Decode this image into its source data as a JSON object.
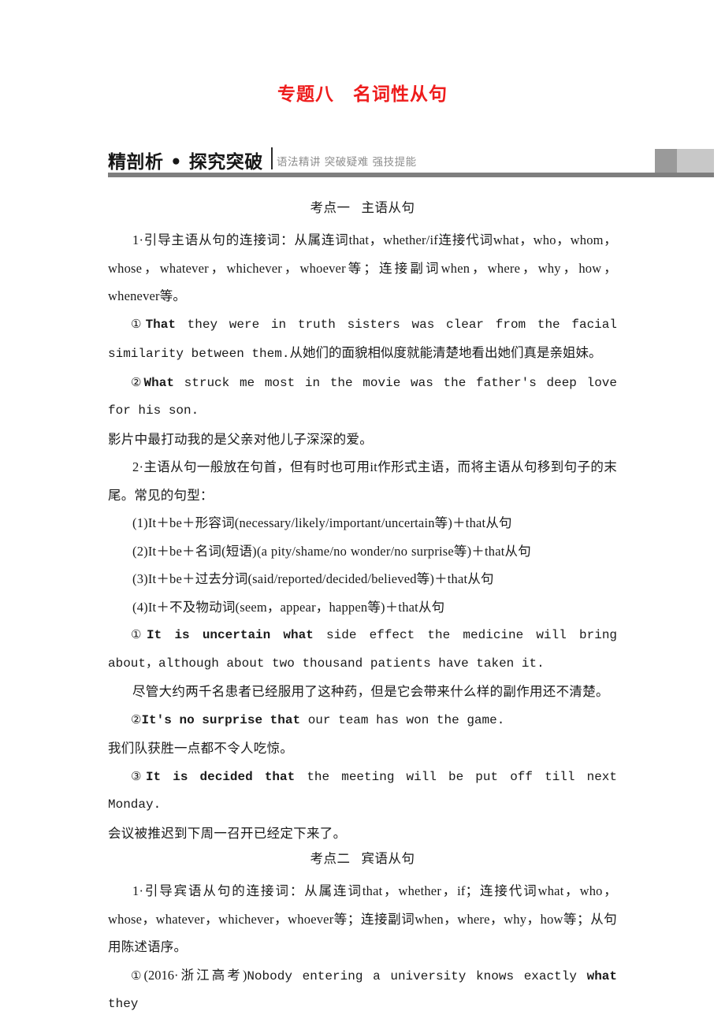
{
  "document": {
    "title": "专题八　名词性从句",
    "section_header": {
      "title": "精剖析 • 探究突破",
      "subtitle": "语法精讲  突破疑难  强技提能",
      "accent_color": "#7e7e7e",
      "title_color": "#171717",
      "subtitle_color": "#8d8d8d",
      "title_accent_color": "#ee1c1c"
    }
  },
  "kaodian_one": {
    "label": "考点一",
    "name": "主语从句"
  },
  "point1": {
    "text": "1·引导主语从句的连接词：从属连词that，whether/if连接代词what，who，whom，whose，whatever，whichever，whoever等；连接副词when，where，why，how，whenever等。"
  },
  "example_1_1": {
    "marker": "①",
    "bold": "That",
    "rest": " they were in truth sisters was clear from the facial similarity between them.",
    "translation": "从她们的面貌相似度就能清楚地看出她们真是亲姐妹。"
  },
  "example_1_2": {
    "marker": "②",
    "bold": "What",
    "rest": " struck me most in the movie was the father's deep love for his son.",
    "translation": "影片中最打动我的是父亲对他儿子深深的爱。"
  },
  "point2": {
    "text": "2·主语从句一般放在句首，但有时也可用it作形式主语，而将主语从句移到句子的末尾。常见的句型："
  },
  "patterns": [
    "(1)It＋be＋形容词(necessary/likely/important/uncertain等)＋that从句",
    "(2)It＋be＋名词(短语)(a pity/shame/no wonder/no surprise等)＋that从句",
    "(3)It＋be＋过去分词(said/reported/decided/believed等)＋that从句",
    "(4)It＋不及物动词(seem，appear，happen等)＋that从句"
  ],
  "example_2_1": {
    "marker": "①",
    "bold": "It is uncertain what",
    "rest": " side effect the medicine will bring about，although about two thousand patients have taken it.",
    "translation": "尽管大约两千名患者已经服用了这种药，但是它会带来什么样的副作用还不清楚。"
  },
  "example_2_2": {
    "marker": "②",
    "bold": "It's no surprise that",
    "rest": " our team has won the game.",
    "translation": "我们队获胜一点都不令人吃惊。"
  },
  "example_2_3": {
    "marker": "③",
    "bold": "It is decided that",
    "rest": " the meeting will be put off till next Monday.",
    "translation": "会议被推迟到下周一召开已经定下来了。"
  },
  "kaodian_two": {
    "label": "考点二",
    "name": "宾语从句"
  },
  "point3": {
    "text": "1·引导宾语从句的连接词：从属连词that，whether，if；连接代词what，who，whose，whatever，whichever，whoever等；连接副词when，where，why，how等；从句用陈述语序。"
  },
  "example_3_1": {
    "marker": "①",
    "source": "(2016·浙江高考)",
    "pre": "Nobody entering a university knows exactly ",
    "bold": "what",
    "rest": " they"
  }
}
